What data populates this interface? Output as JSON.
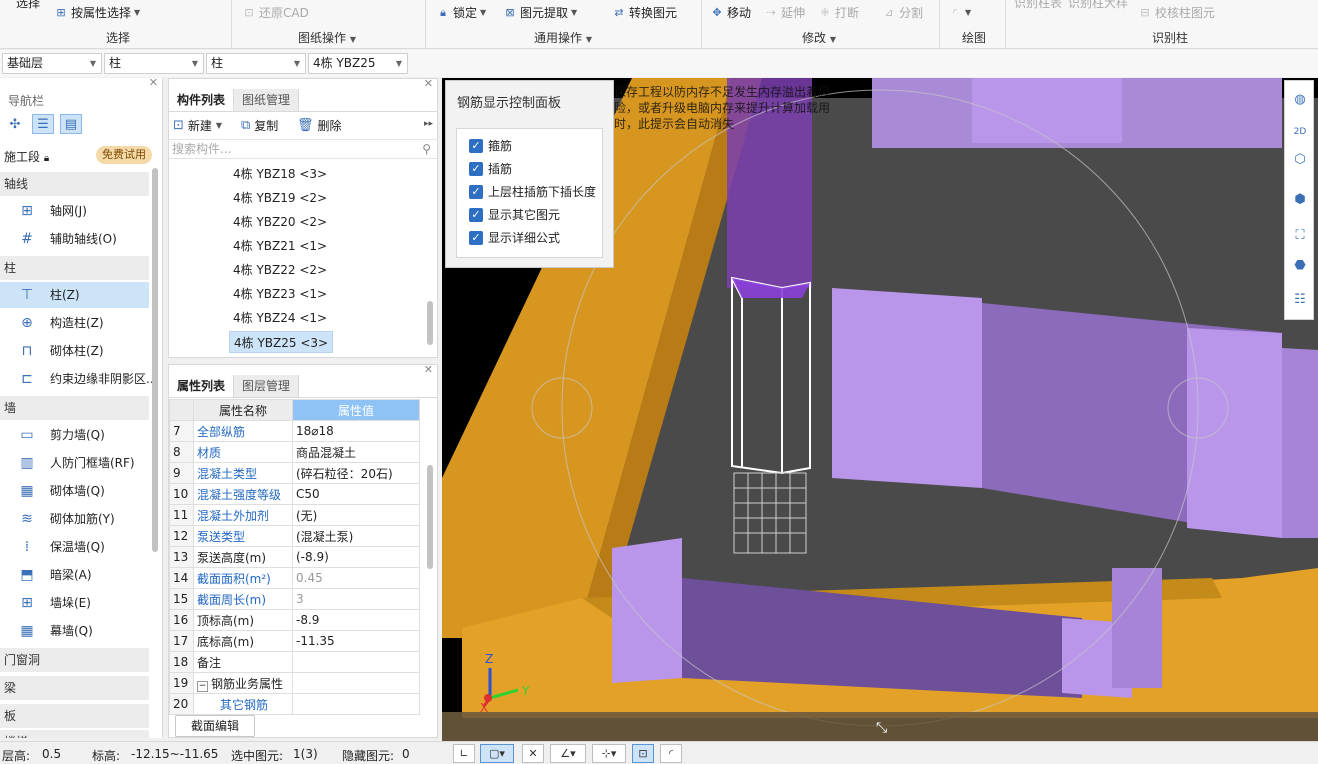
{
  "ribbon": {
    "select_top": "选择",
    "by_attr_select": "按属性选择",
    "select_group": "选择",
    "restore_cad": "还原CAD",
    "drawing_ops": "图纸操作",
    "lock": "锁定",
    "element_extract": "图元提取",
    "convert_element": "转换图元",
    "common_ops": "通用操作",
    "move": "移动",
    "extend": "延伸",
    "break": "打断",
    "split": "分割",
    "modify": "修改",
    "draw": "绘图",
    "identify_table": "识别柱表",
    "identify_detail": "识别柱大样",
    "check_column": "校核柱图元",
    "identify_column": "识别柱"
  },
  "dropdowns": {
    "floor": "基础层",
    "category": "柱",
    "type": "柱",
    "component": "4栋 YBZ25"
  },
  "nav": {
    "title": "导航栏",
    "construction_stage": "施工段",
    "free_trial": "免费试用",
    "sections": {
      "axis": "轴线",
      "column": "柱",
      "wall": "墙",
      "door_window": "门窗洞",
      "beam": "梁",
      "slab": "板",
      "stair": "楼梯"
    },
    "items": {
      "grid": "轴网(J)",
      "aux_axis": "辅助轴线(O)",
      "column": "柱(Z)",
      "struct_column": "构造柱(Z)",
      "masonry_column": "砌体柱(Z)",
      "constraint_edge": "约束边缘非阴影区...",
      "shear_wall": "剪力墙(Q)",
      "civil_defense_wall": "人防门框墙(RF)",
      "masonry_wall": "砌体墙(Q)",
      "masonry_rebar": "砌体加筋(Y)",
      "insulation_wall": "保温墙(Q)",
      "hidden_beam": "暗梁(A)",
      "wall_pier": "墙垛(E)",
      "curtain_wall": "幕墙(Q)"
    }
  },
  "component_panel": {
    "tab_list": "构件列表",
    "tab_drawing": "图纸管理",
    "new": "新建",
    "copy": "复制",
    "delete": "删除",
    "search_placeholder": "搜索构件...",
    "items": [
      "4栋 YBZ18 <3>",
      "4栋 YBZ19 <2>",
      "4栋 YBZ20 <2>",
      "4栋 YBZ21 <1>",
      "4栋 YBZ22 <2>",
      "4栋 YBZ23 <1>",
      "4栋 YBZ24 <1>",
      "4栋 YBZ25 <3>"
    ]
  },
  "property_panel": {
    "tab_props": "属性列表",
    "tab_layers": "图层管理",
    "col_name": "属性名称",
    "col_value": "属性值",
    "rows": [
      {
        "n": "7",
        "k": "全部纵筋",
        "v": "18⌀18"
      },
      {
        "n": "8",
        "k": "材质",
        "v": "商品混凝土"
      },
      {
        "n": "9",
        "k": "混凝土类型",
        "v": "(碎石粒径：20石)"
      },
      {
        "n": "10",
        "k": "混凝土强度等级",
        "v": "C50"
      },
      {
        "n": "11",
        "k": "混凝土外加剂",
        "v": "(无)"
      },
      {
        "n": "12",
        "k": "泵送类型",
        "v": "(混凝土泵)"
      },
      {
        "n": "13",
        "k": "泵送高度(m)",
        "v": "(-8.9)"
      },
      {
        "n": "14",
        "k": "截面面积(m²)",
        "v": "0.45"
      },
      {
        "n": "15",
        "k": "截面周长(m)",
        "v": "3"
      },
      {
        "n": "16",
        "k": "顶标高(m)",
        "v": "-8.9"
      },
      {
        "n": "17",
        "k": "底标高(m)",
        "v": "-11.35"
      },
      {
        "n": "18",
        "k": "备注",
        "v": ""
      },
      {
        "n": "19",
        "k": "钢筋业务属性",
        "v": ""
      },
      {
        "n": "20",
        "k": "其它钢筋",
        "v": ""
      }
    ],
    "section_edit": "截面编辑"
  },
  "rebar_panel": {
    "title": "钢筋显示控制面板",
    "options": [
      "箍筋",
      "插筋",
      "上层柱插筋下插长度",
      "显示其它图元",
      "显示详细公式"
    ]
  },
  "warning": "保存工程以防内存不足发生内存溢出着风险，或者升级电脑内存来提升计算加载用时，此提示会自动消失",
  "axes": {
    "z": "Z",
    "y": "Y",
    "x": "X"
  },
  "status": {
    "floor_height_label": "层高:",
    "floor_height": "0.5",
    "elevation_label": "标高:",
    "elevation": "-12.15~-11.65",
    "selected_label": "选中图元:",
    "selected": "1(3)",
    "hidden_label": "隐藏图元:",
    "hidden": "0"
  },
  "colors": {
    "accent": "#2f6fc3",
    "orange": "#e3a227",
    "purple": "#b48ee6",
    "floor": "#4a4a4a"
  }
}
